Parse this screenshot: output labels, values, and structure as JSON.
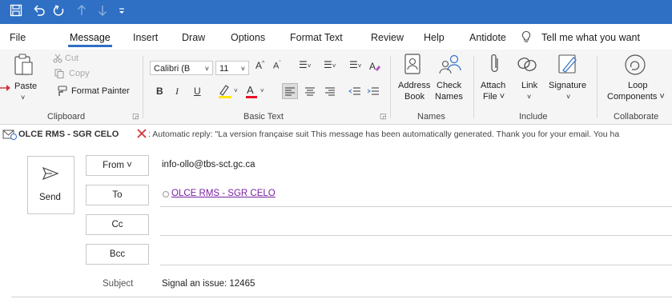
{
  "quick_access": {
    "icons": [
      "save-icon",
      "undo-icon",
      "redo-icon",
      "up-arrow-icon",
      "down-arrow-icon",
      "customize-qat-icon"
    ]
  },
  "menu": {
    "tabs": [
      "File",
      "Message",
      "Insert",
      "Draw",
      "Options",
      "Format Text",
      "Review",
      "Help",
      "Antidote"
    ],
    "active_tab": "Message",
    "tell_me": "Tell me what you want"
  },
  "ribbon": {
    "clipboard": {
      "paste": "Paste",
      "cut": "Cut",
      "copy": "Copy",
      "format_painter": "Format Painter",
      "label": "Clipboard"
    },
    "basic_text": {
      "font": "Calibri (B",
      "size": "11",
      "label": "Basic Text"
    },
    "names": {
      "address_book_1": "Address",
      "address_book_2": "Book",
      "check_names_1": "Check",
      "check_names_2": "Names",
      "label": "Names"
    },
    "include": {
      "attach_1": "Attach",
      "attach_2": "File ˅",
      "link": "Link",
      "signature": "Signature",
      "label": "Include"
    },
    "collaborate": {
      "loop_1": "Loop",
      "loop_2": "Components ˅",
      "label": "Collaborate"
    }
  },
  "info_bar": {
    "recipient": "OLCE RMS - SGR CELO",
    "message": ": Automatic reply: \"La version française suit   This message has been automatically generated.   Thank you for your email. You ha"
  },
  "compose": {
    "send": "Send",
    "from_label": "From ˅",
    "from_value": "info-ollo@tbs-sct.gc.ca",
    "to_label": "To",
    "to_value": "OLCE RMS - SGR CELO",
    "cc_label": "Cc",
    "bcc_label": "Bcc",
    "subject_label": "Subject",
    "subject_value": "Signal an issue: 12465"
  },
  "colors": {
    "title_bar": "#2f6fc4",
    "link": "#7a1fa2",
    "remove_x": "#d13438",
    "highlight": "#ffe800",
    "font_color": "#e81123"
  }
}
